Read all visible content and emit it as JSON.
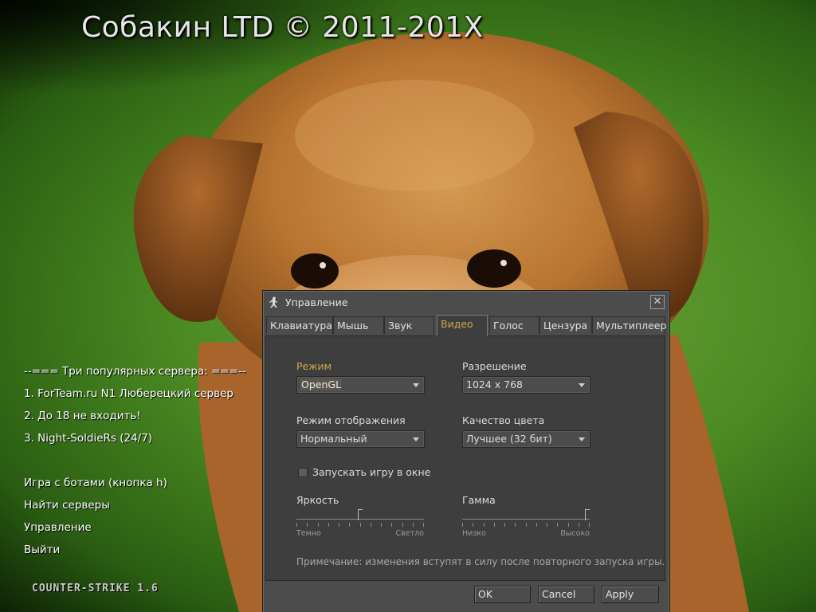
{
  "background_title": "Собакин LTD ©  2011-201X",
  "left_menu": {
    "servers_header": "--=== Три популярных сервера: ===--",
    "servers": [
      "1. ForTeam.ru N1 Люберецкий сервер",
      "2. До 18 не входить!",
      "3. Night-SoldieRs (24/7)"
    ],
    "actions": [
      "Игра с ботами (кнопка h)",
      "Найти серверы",
      "Управление",
      "Выйти"
    ]
  },
  "game_logo_text": "COUNTER-STRIKE 1.6",
  "dialog": {
    "title": "Управление",
    "close_glyph": "✕",
    "tabs": [
      "Клавиатура",
      "Мышь",
      "Звук",
      "Видео",
      "Голос",
      "Цензура",
      "Мультиплеер"
    ],
    "active_tab": "Видео",
    "video": {
      "mode_label": "Режим",
      "mode_value": "OpenGL",
      "resolution_label": "Разрешение",
      "resolution_value": "1024 x 768",
      "display_mode_label": "Режим отображения",
      "display_mode_value": "Нормальный",
      "color_quality_label": "Качество цвета",
      "color_quality_value": "Лучшее (32 бит)",
      "windowed_label": "Запускать игру в окне",
      "windowed_checked": false,
      "brightness_label": "Яркость",
      "brightness_min": "Темно",
      "brightness_max": "Светло",
      "brightness_fraction": 0.5,
      "gamma_label": "Гамма",
      "gamma_min": "Низко",
      "gamma_max": "Высоко",
      "gamma_fraction": 1.0,
      "note": "Примечание: изменения вступят в силу после повторного запуска игры."
    },
    "buttons": {
      "ok": "OK",
      "cancel": "Cancel",
      "apply": "Apply"
    }
  },
  "colors": {
    "dialog_bg": "#4c4c4c",
    "panel_bg": "#3e3e3e",
    "accent": "#c9a94a",
    "text": "#dcdcdc"
  }
}
